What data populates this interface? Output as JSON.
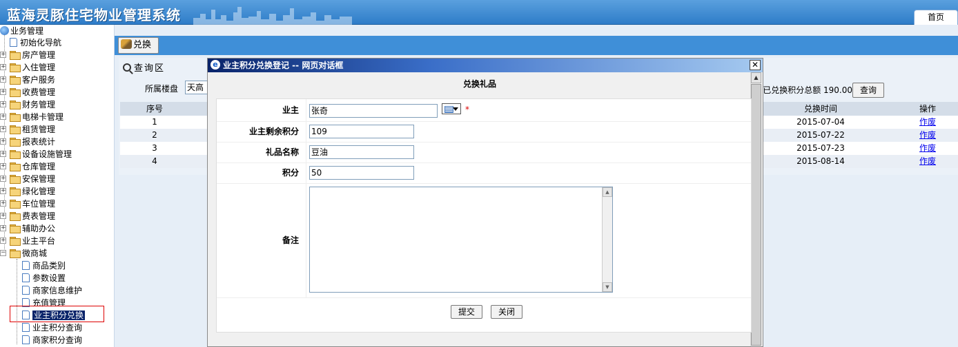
{
  "app": {
    "title": "蓝海灵豚住宅物业管理系统",
    "home_tab": "首页"
  },
  "sidebar": {
    "root": "业务管理",
    "items": [
      {
        "label": "初始化导航",
        "type": "page"
      },
      {
        "label": "房产管理",
        "type": "folder"
      },
      {
        "label": "入住管理",
        "type": "folder"
      },
      {
        "label": "客户服务",
        "type": "folder"
      },
      {
        "label": "收费管理",
        "type": "folder"
      },
      {
        "label": "财务管理",
        "type": "folder"
      },
      {
        "label": "电梯卡管理",
        "type": "folder"
      },
      {
        "label": "租赁管理",
        "type": "folder"
      },
      {
        "label": "报表统计",
        "type": "folder"
      },
      {
        "label": "设备设施管理",
        "type": "folder"
      },
      {
        "label": "仓库管理",
        "type": "folder"
      },
      {
        "label": "安保管理",
        "type": "folder"
      },
      {
        "label": "绿化管理",
        "type": "folder"
      },
      {
        "label": "车位管理",
        "type": "folder"
      },
      {
        "label": "费表管理",
        "type": "folder"
      },
      {
        "label": "辅助办公",
        "type": "folder"
      },
      {
        "label": "业主平台",
        "type": "folder"
      },
      {
        "label": "微商城",
        "type": "folder-open"
      }
    ],
    "subitems": [
      {
        "label": "商品类别"
      },
      {
        "label": "参数设置"
      },
      {
        "label": "商家信息维护"
      },
      {
        "label": "充值管理"
      },
      {
        "label": "业主积分兑换",
        "selected": true
      },
      {
        "label": "业主积分查询"
      },
      {
        "label": "商家积分查询"
      }
    ]
  },
  "toolbar": {
    "exchange_label": "兑换"
  },
  "query": {
    "title": "查询区",
    "building_label": "所属楼盘",
    "building_value": "天高",
    "total_text": "已兑换积分总额 190.00",
    "query_button": "查询"
  },
  "grid": {
    "headers": {
      "no": "序号",
      "time": "兑换时间",
      "op": "操作"
    },
    "rows": [
      {
        "no": "1",
        "time": "2015-07-04",
        "op": "作废"
      },
      {
        "no": "2",
        "time": "2015-07-22",
        "op": "作废"
      },
      {
        "no": "3",
        "time": "2015-07-23",
        "op": "作废"
      },
      {
        "no": "4",
        "time": "2015-08-14",
        "op": "作废"
      }
    ]
  },
  "dialog": {
    "title": "业主积分兑换登记 -- 网页对话框",
    "header": "兑换礼品",
    "fields": {
      "owner_label": "业主",
      "owner_value": "张奇",
      "points_left_label": "业主剩余积分",
      "points_left_value": "109",
      "gift_label": "礼品名称",
      "gift_value": "豆油",
      "points_label": "积分",
      "points_value": "50",
      "remark_label": "备注"
    },
    "required_mark": "*",
    "submit_button": "提交",
    "close_button": "关闭"
  }
}
